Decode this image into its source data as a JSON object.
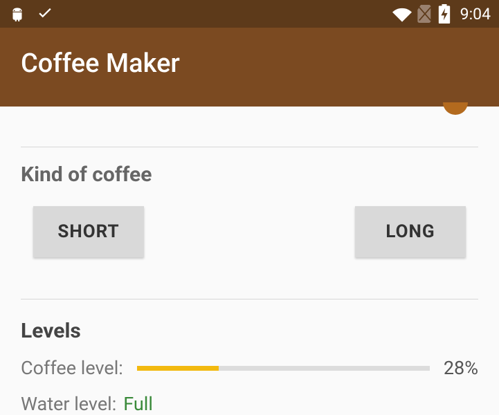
{
  "statusbar": {
    "time": "9:04"
  },
  "appbar": {
    "title": "Coffee Maker"
  },
  "kind_section": {
    "title": "Kind of coffee",
    "short_label": "SHORT",
    "long_label": "LONG"
  },
  "levels_section": {
    "title": "Levels",
    "coffee_label": "Coffee level:",
    "coffee_percent": 28,
    "coffee_value": "28%",
    "water_label": "Water level:",
    "water_value": "Full"
  },
  "colors": {
    "accent": "#f2b90f",
    "appbar": "#7b4a21",
    "statusbar": "#5d3a1a"
  }
}
